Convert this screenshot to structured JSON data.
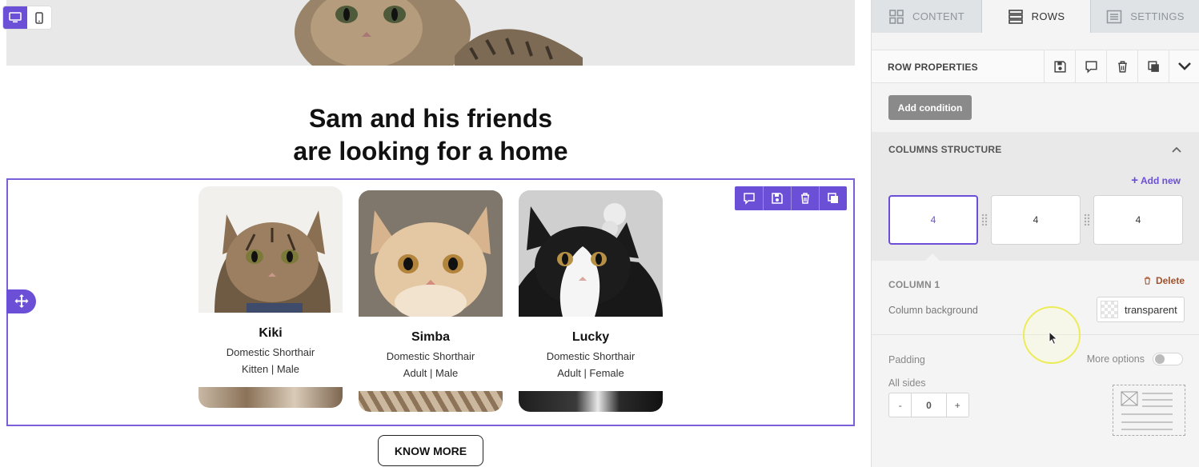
{
  "canvas": {
    "device_modes": [
      "desktop-icon",
      "mobile-icon"
    ],
    "active_device": "desktop",
    "headline_line1": "Sam and his friends",
    "headline_line2": "are looking for a home",
    "cards": [
      {
        "name": "Kiki",
        "breed": "Domestic Shorthair",
        "meta": "Kitten | Male"
      },
      {
        "name": "Simba",
        "breed": "Domestic Shorthair",
        "meta": "Adult | Male"
      },
      {
        "name": "Lucky",
        "breed": "Domestic Shorthair",
        "meta": "Adult | Female"
      }
    ],
    "row_tools": [
      "comment-icon",
      "save-icon",
      "trash-icon",
      "duplicate-icon"
    ],
    "cta_label": "KNOW MORE",
    "accent": "#6b4fd6"
  },
  "panel": {
    "tabs": [
      {
        "label": "CONTENT",
        "icon": "grid-icon"
      },
      {
        "label": "ROWS",
        "icon": "rows-icon",
        "active": true
      },
      {
        "label": "SETTINGS",
        "icon": "settings-icon"
      }
    ],
    "row_properties": {
      "title": "ROW PROPERTIES",
      "actions": [
        "save-icon",
        "comment-icon",
        "trash-icon",
        "duplicate-icon",
        "chevron-down-icon"
      ],
      "add_condition": "Add condition"
    },
    "columns_structure": {
      "title": "COLUMNS STRUCTURE",
      "add_new": "Add new",
      "columns": [
        "4",
        "4",
        "4"
      ],
      "selected": 0
    },
    "column": {
      "title": "COLUMN 1",
      "delete_label": "Delete",
      "background_label": "Column background",
      "background_value": "transparent",
      "padding_label": "Padding",
      "more_options_label": "More options",
      "more_options_on": false,
      "all_sides_label": "All sides",
      "padding_value": "0",
      "decrement": "-",
      "increment": "+"
    }
  }
}
